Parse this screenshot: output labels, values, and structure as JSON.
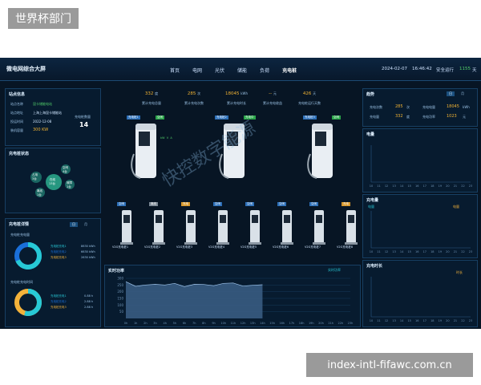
{
  "caption_top": "世界杯部门",
  "caption_bottom": "index-intl-fifawc.com.cn",
  "dashboard": {
    "title": "微电网综合大屏",
    "nav": [
      "首页",
      "电网",
      "光伏",
      "储能",
      "负荷",
      "充电桩"
    ],
    "active_nav": "充电桩",
    "date": "2024-02-07",
    "time": "16:46:42",
    "safe_label": "安全运行",
    "safe_days": "1155",
    "safe_unit": "天"
  },
  "station_info": {
    "title": "站点信息",
    "rows": [
      {
        "label": "站点名称",
        "value": "昆卡储能电站"
      },
      {
        "label": "站点地址",
        "value": "上海上海昆卡储能站"
      },
      {
        "label": "投运时间",
        "value": "2022-12-08"
      },
      {
        "label": "装机容量",
        "value": "300 KW"
      }
    ],
    "pile_count_label": "充电桩数量",
    "pile_count": "14"
  },
  "pile_status": {
    "title": "充电桩状态",
    "bubbles": [
      {
        "label": "占用",
        "value": "3台"
      },
      {
        "label": "空闲",
        "value": "4台"
      },
      {
        "label": "在线",
        "value": "13台"
      },
      {
        "label": "故障",
        "value": "1台"
      },
      {
        "label": "离线",
        "value": "1台"
      }
    ]
  },
  "pile_details": {
    "title": "充电桩详情",
    "tabs": [
      "日",
      "月"
    ],
    "section1": "充电桩充电量",
    "section2": "充电桩充电时间",
    "legend1": [
      {
        "name": "充电桩充电1",
        "value": "8630 kWh"
      },
      {
        "name": "充电桩充电2",
        "value": "6630 kWh"
      },
      {
        "name": "充电桩充电3",
        "value": "2630 kWh"
      }
    ],
    "legend2": [
      {
        "name": "充电桩充电1",
        "value": "0.88 h"
      },
      {
        "name": "充电桩充电2",
        "value": "2.88 h"
      },
      {
        "name": "充电桩充电3",
        "value": "2.88 h"
      }
    ],
    "colors": [
      "#27c9d6",
      "#1a6fd9",
      "#f3b23a"
    ]
  },
  "top_stats": [
    {
      "value": "332",
      "unit": "度",
      "label": "累计充电总量"
    },
    {
      "value": "285",
      "unit": "次",
      "label": "累计充电次数"
    },
    {
      "value": "18045",
      "unit": "kWh",
      "label": "累计充电时长"
    },
    {
      "value": "--",
      "unit": "元",
      "label": "累计充电收益"
    },
    {
      "value": "426",
      "unit": "天",
      "label": "充电桩运行天数"
    }
  ],
  "big_chargers": [
    {
      "name": "充电桩1",
      "status": "空闲"
    },
    {
      "name": "充电桩2",
      "status": "充电中"
    },
    {
      "name": "充电桩3",
      "status": "空闲"
    }
  ],
  "small_chargers": [
    {
      "name": "V2G充电桩1",
      "status": "空闲"
    },
    {
      "name": "V2G充电桩2",
      "status": "离线"
    },
    {
      "name": "V2G充电桩3",
      "status": "充电"
    },
    {
      "name": "V2G充电桩4",
      "status": "空闲"
    },
    {
      "name": "V2G充电桩5",
      "status": "空闲"
    },
    {
      "name": "V2G充电桩6",
      "status": "空闲"
    },
    {
      "name": "V2G充电桩7",
      "status": "空闲"
    },
    {
      "name": "V2G充电桩8",
      "status": "充电"
    }
  ],
  "realtime": {
    "title": "实时功率",
    "legend": "实时功率",
    "yticks": [
      "300",
      "250",
      "200",
      "150",
      "100",
      "50"
    ],
    "xticks": [
      "0h",
      "1h",
      "2h",
      "3h",
      "4h",
      "5h",
      "6h",
      "7h",
      "8h",
      "9h",
      "10h",
      "11h",
      "12h",
      "13h",
      "14h",
      "15h",
      "16h",
      "17h",
      "18h",
      "19h",
      "20h",
      "21h",
      "22h",
      "23h"
    ],
    "chart_data": {
      "type": "area",
      "x": [
        "0h",
        "1h",
        "2h",
        "3h",
        "4h",
        "5h",
        "6h",
        "7h",
        "8h",
        "9h",
        "10h",
        "11h",
        "12h",
        "13h",
        "14h"
      ],
      "values": [
        275,
        240,
        250,
        255,
        250,
        262,
        238,
        255,
        254,
        245,
        262,
        265,
        242,
        248,
        252
      ],
      "ylim": [
        0,
        300
      ]
    }
  },
  "trend": {
    "title": "趋势",
    "tabs": [
      "日",
      "月"
    ],
    "rows": [
      {
        "l1": "充电次数",
        "v1": "285",
        "u1": "次",
        "l2": "充电电量",
        "v2": "18045",
        "u2": "kWh"
      },
      {
        "l1": "充电量",
        "v1": "332",
        "u1": "度",
        "l2": "充电功率",
        "v2": "1023",
        "u2": "元"
      }
    ]
  },
  "right_charts": [
    {
      "title": "电量",
      "legend": "",
      "xticks": [
        "10",
        "11",
        "12",
        "13",
        "14",
        "15",
        "16",
        "17",
        "18",
        "19",
        "20",
        "21",
        "22",
        "23"
      ]
    },
    {
      "title": "充电量",
      "legend": "电量",
      "ylabel": "电量",
      "xticks": [
        "10",
        "11",
        "12",
        "13",
        "14",
        "15",
        "16",
        "17",
        "18",
        "19",
        "20",
        "21",
        "22",
        "23"
      ]
    },
    {
      "title": "充电时长",
      "legend": "时长",
      "xticks": [
        "10",
        "11",
        "12",
        "13",
        "14",
        "15",
        "16",
        "17",
        "18",
        "19",
        "20",
        "21",
        "22",
        "23"
      ]
    }
  ],
  "watermark": "快控数字能源"
}
